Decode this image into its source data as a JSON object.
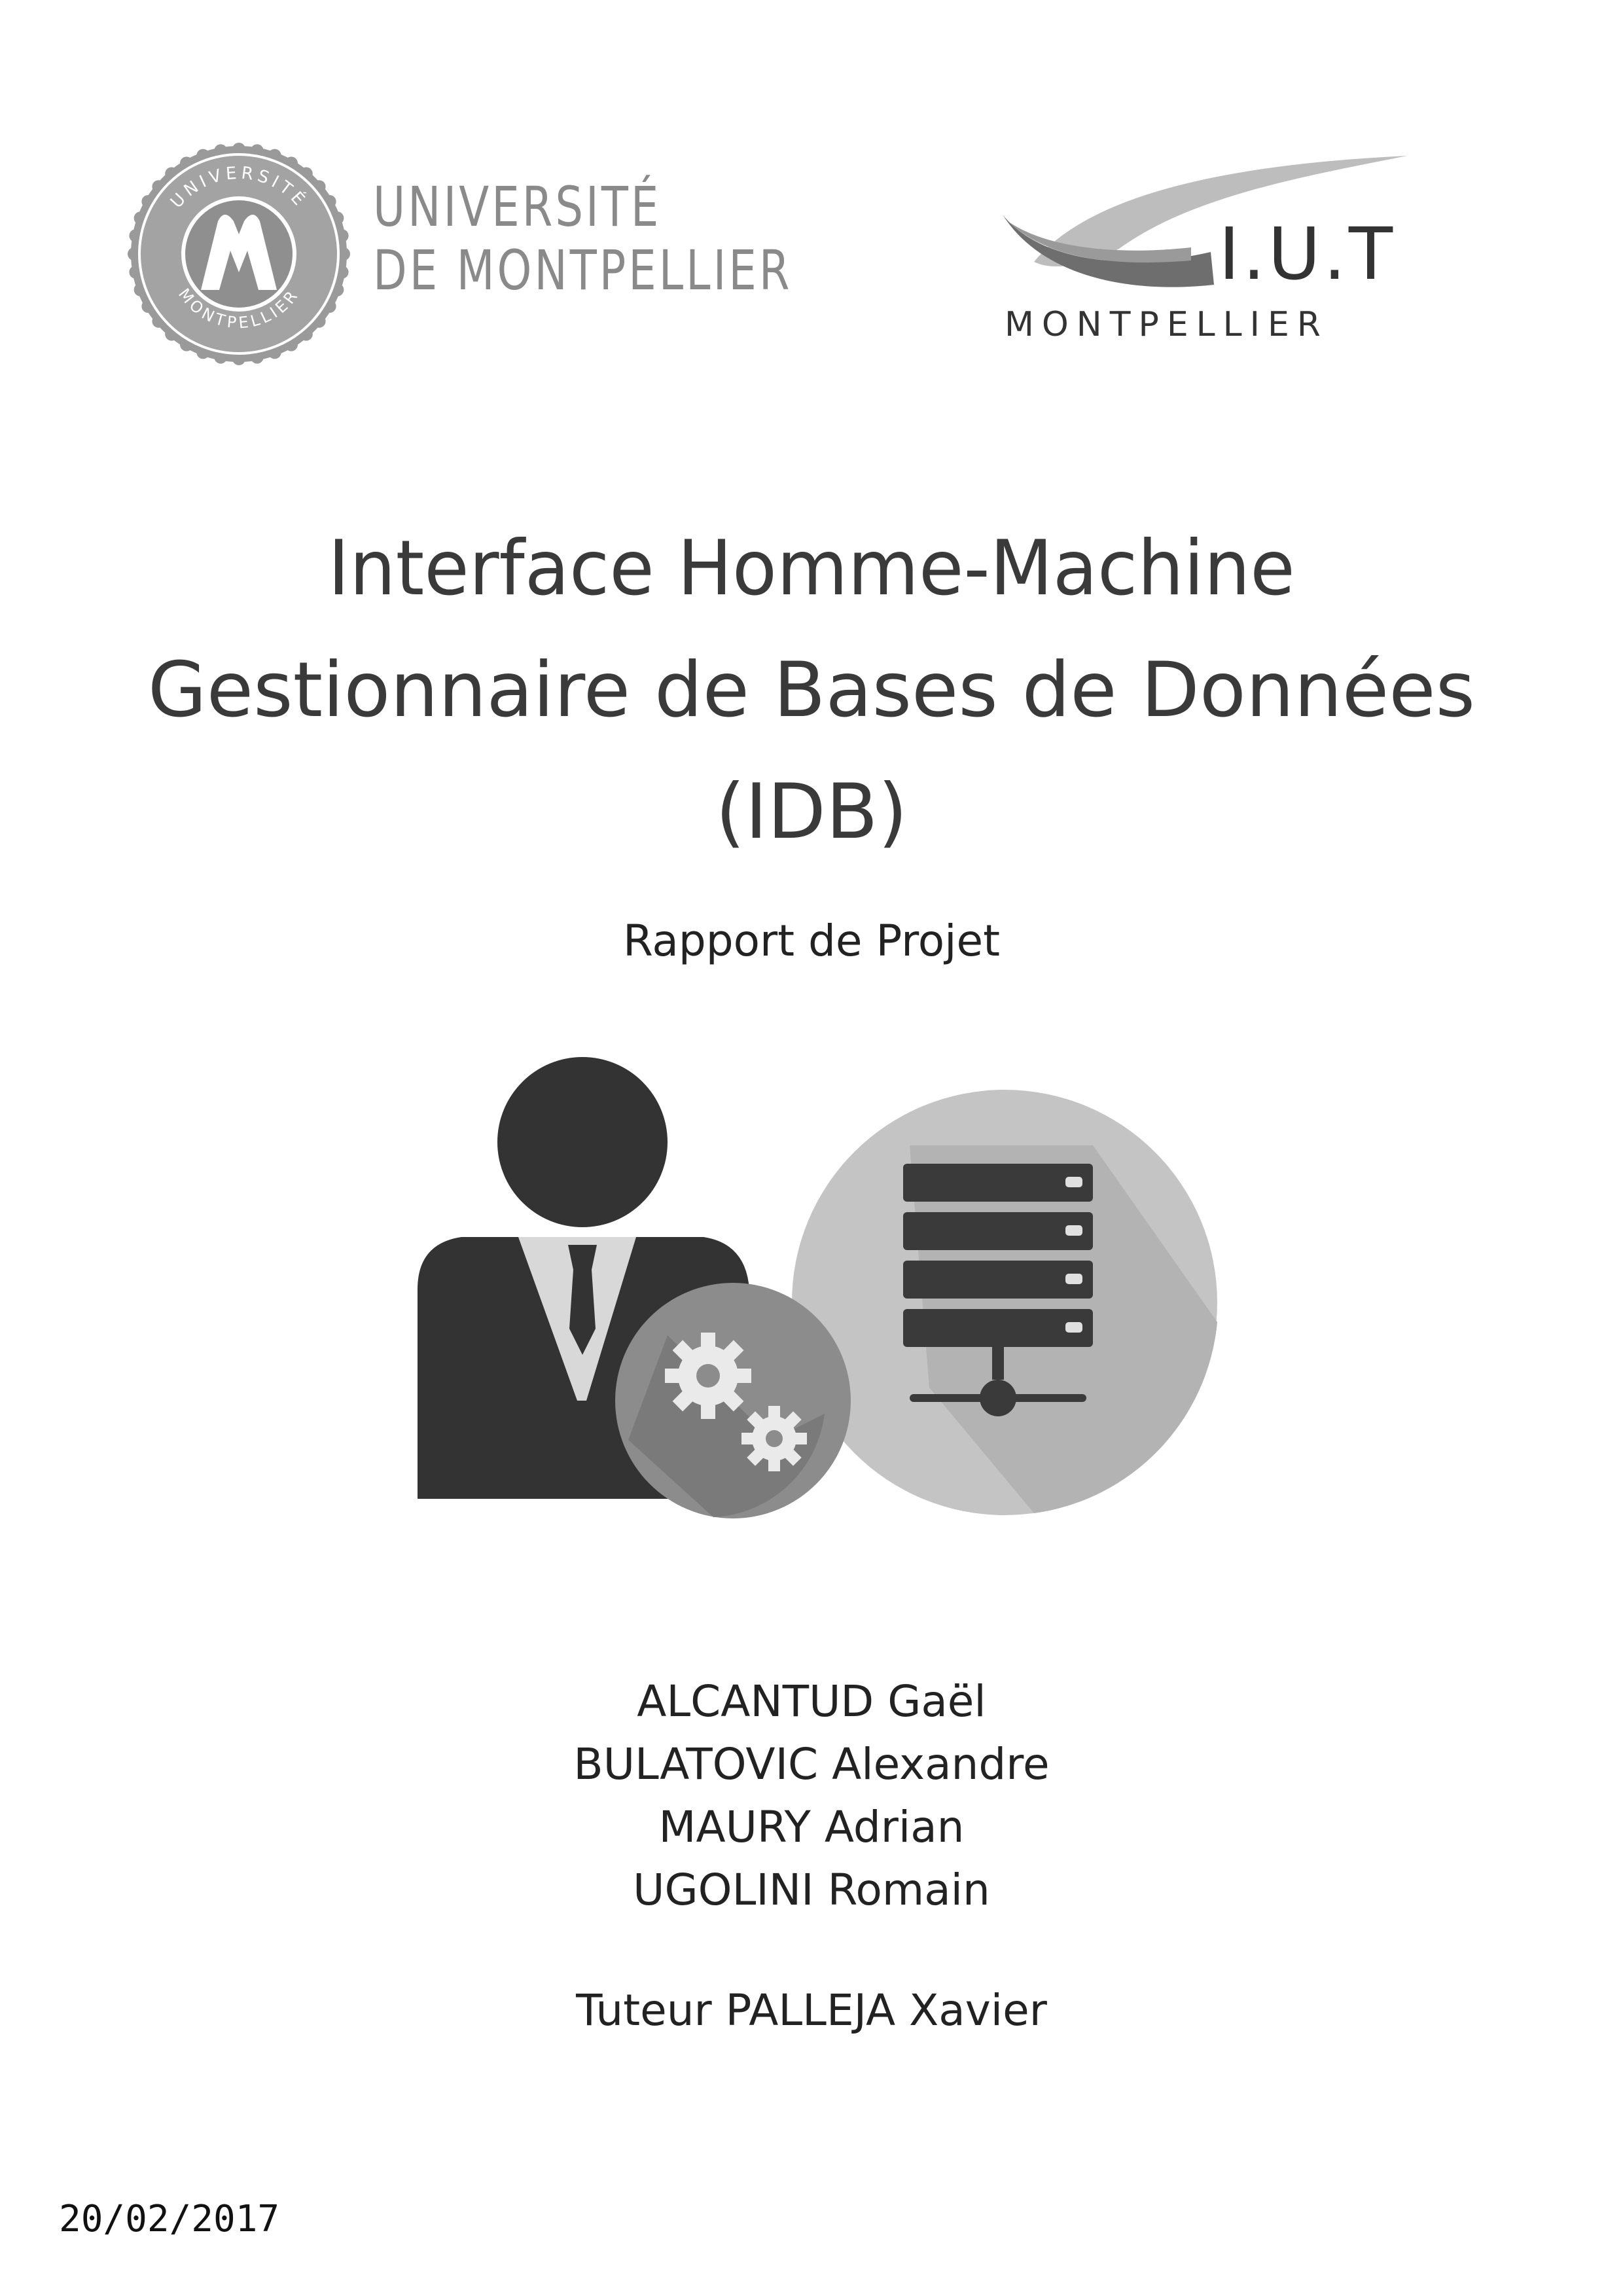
{
  "logos": {
    "university": {
      "seal_ring_text_top": "UNIVERSITÉ",
      "seal_ring_text_bottom": "MONTPELLIER",
      "name_line_1": "UNIVERSITÉ",
      "name_line_2": "DE MONTPELLIER"
    },
    "iut": {
      "abbrev": "I.U.T",
      "city": "MONTPELLIER"
    }
  },
  "title": {
    "line_1": "Interface Homme-Machine",
    "line_2": "Gestionnaire de Bases de Données",
    "line_3": "(IDB)"
  },
  "subtitle": "Rapport de Projet",
  "illustration": {
    "icons": [
      "person-icon",
      "gears-icon",
      "database-server-icon"
    ]
  },
  "authors": [
    "ALCANTUD Gaël",
    "BULATOVIC Alexandre",
    "MAURY Adrian",
    "UGOLINI Romain"
  ],
  "tutor": "Tuteur PALLEJA Xavier",
  "date": "20/02/2017",
  "colors": {
    "dark": "#333333",
    "logo_grey": "#8a8a8a",
    "mid_grey": "#8c8c8c",
    "light_grey": "#c4c4c4",
    "background": "#ffffff"
  }
}
